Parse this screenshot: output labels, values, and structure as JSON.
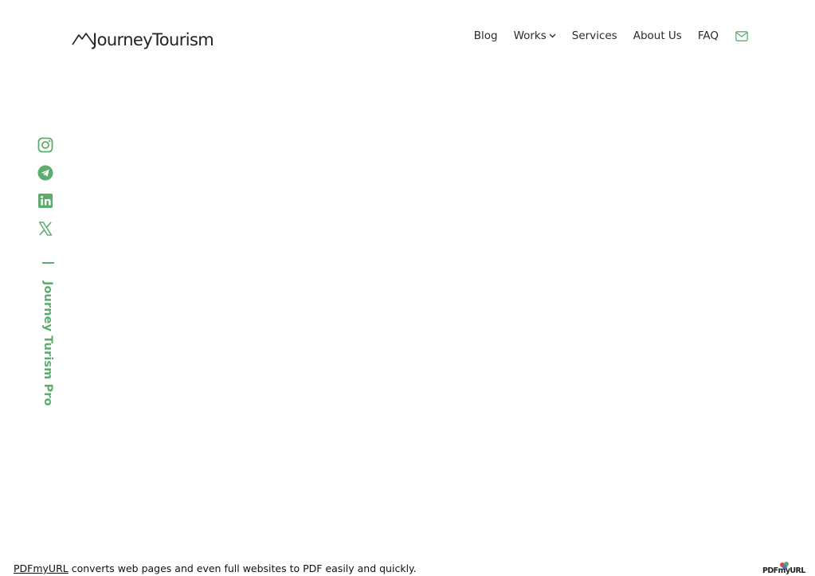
{
  "header": {
    "logo_text": "JourneyTourism",
    "nav": {
      "blog": "Blog",
      "works": "Works",
      "services": "Services",
      "about": "About Us",
      "faq": "FAQ"
    }
  },
  "sidebar": {
    "social_icons": [
      "instagram-icon",
      "telegram-icon",
      "linkedin-icon",
      "x-icon"
    ],
    "vertical_text": "Journey Turism Pro"
  },
  "footer": {
    "link_text": "PDFmyURL",
    "message": " converts web pages and even full websites to PDF easily and quickly.",
    "badge_text": "PDFmyURL"
  },
  "colors": {
    "accent": "#5cac6e",
    "text": "#222222",
    "background": "#ffffff"
  }
}
